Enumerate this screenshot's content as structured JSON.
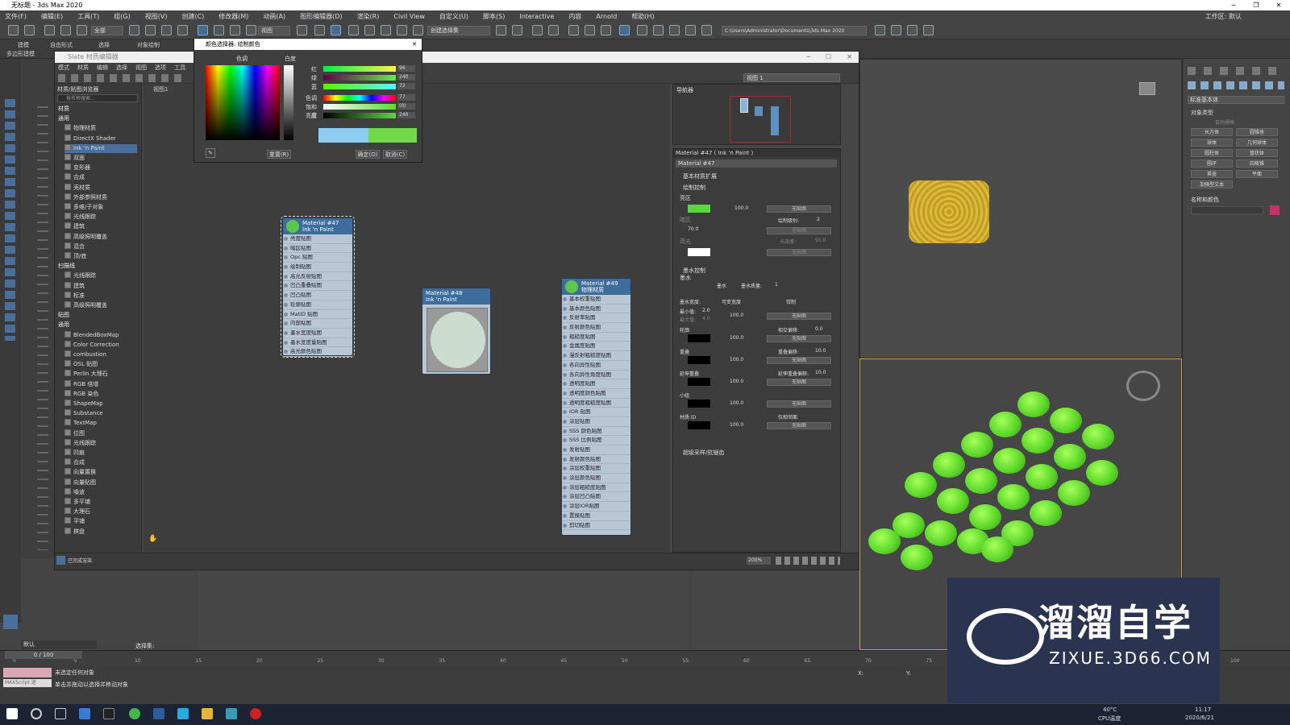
{
  "app": {
    "title": "无标题 - 3ds Max 2020",
    "window_controls": [
      "─",
      "❐",
      "✕"
    ]
  },
  "menubar": {
    "items": [
      "文件(F)",
      "编辑(E)",
      "工具(T)",
      "组(G)",
      "视图(V)",
      "创建(C)",
      "修改器(M)",
      "动画(A)",
      "图形编辑器(D)",
      "渲染(R)",
      "Civil View",
      "自定义(U)",
      "脚本(S)",
      "Interactive",
      "内容",
      "Arnold",
      "帮助(H)"
    ],
    "workspace_label": "工作区:",
    "workspace_value": "默认"
  },
  "toolbar": {
    "filter_select": "全部",
    "view_select": "视图",
    "selection_set": "创建选择集",
    "path": "C:\\Users\\Administrator\\Documents\\3ds Max 2020"
  },
  "ribbon": {
    "tabs": [
      "建模",
      "自由形式",
      "选择",
      "对象绘制"
    ],
    "subtab": "多边形建模"
  },
  "slate": {
    "title": "Slate 材质编辑器",
    "menu": [
      "模式",
      "材质",
      "编辑",
      "选择",
      "视图",
      "选项",
      "工具"
    ],
    "browser_title": "材质/贴图浏览器",
    "search_placeholder": "按名称搜索...",
    "view_tab": "视图1",
    "view_select": "视图 1",
    "nav_title": "导航器",
    "status_text": "已完成渲染",
    "zoom": "200%",
    "browser": {
      "section_materials": "材质",
      "group_general": "通用",
      "general_items": [
        "物理材质",
        "DirectX Shader",
        "Ink 'n Paint",
        "双面",
        "变形器",
        "合成",
        "壳材质",
        "外部参照材质",
        "多维/子对象",
        "光线跟踪",
        "建筑",
        "高级照明覆盖",
        "混合",
        "顶/底"
      ],
      "group_scanline": "扫描线",
      "scanline_items": [
        "光线跟踪",
        "建筑",
        "标准",
        "高级照明覆盖"
      ],
      "section_maps": "贴图",
      "group_maps_general": "通用",
      "map_items": [
        "BlendedBoxMap",
        "Color Correction",
        "combustion",
        "OSL 贴图",
        "Perlin 大理石",
        "RGB 倍增",
        "RGB 染色",
        "ShapeMap",
        "Substance",
        "TextMap",
        "位图",
        "光线跟踪",
        "凹痕",
        "合成",
        "向量置换",
        "向量贴图",
        "噪波",
        "多平铺",
        "大理石",
        "平铺",
        "棋盘"
      ]
    },
    "nodes": {
      "ink": {
        "title": "Material #47",
        "subtitle": "Ink 'n Paint",
        "slots": [
          "亮度贴图",
          "暗区贴图",
          "Opc 贴图",
          "绘制贴图",
          "高光反射贴图",
          "凹凸重叠贴图",
          "凹凸贴图",
          "轮廓贴图",
          "MatID 贴图",
          "内部贴图",
          "墨水宽度贴图",
          "墨水宽度量贴图",
          "高光颜色贴图"
        ]
      },
      "std": {
        "title": "Material #48",
        "subtitle": "Ink 'n Paint"
      },
      "phys": {
        "title": "Material #49",
        "subtitle": "物理材质",
        "slots": [
          "基本权重贴图",
          "基本颜色贴图",
          "反射率贴图",
          "反射颜色贴图",
          "粗糙度贴图",
          "金属度贴图",
          "漫反射粗糙度贴图",
          "各向异性贴图",
          "各向异性角度贴图",
          "透明度贴图",
          "透明度颜色贴图",
          "透明度粗糙度贴图",
          "IOR 贴图",
          "涂层贴图",
          "SSS 颜色贴图",
          "SSS 比例贴图",
          "发射贴图",
          "发射颜色贴图",
          "涂层权重贴图",
          "涂层颜色贴图",
          "涂层粗糙度贴图",
          "涂层凹凸贴图",
          "涂层IOR贴图",
          "置换贴图",
          "剪切贴图"
        ]
      }
    },
    "props": {
      "header": "Material #47 ( Ink 'n Paint )",
      "name": "Material #47",
      "rollout_basic": "基本材质扩展",
      "rollout_paint": "绘制控制",
      "lit_label": "亮区",
      "lit_check": "已启用",
      "lit_value": "100.0",
      "no_map": "无贴图",
      "shaded_label": "暗区",
      "shaded_value": "70.0",
      "paint_levels_label": "绘制级别:",
      "paint_levels": "2",
      "highlight_label": "高光",
      "glossiness_label": "光泽度:",
      "glossiness": "50.0",
      "rollout_ink": "墨水控制",
      "ink_label": "墨水",
      "ink_quality_label": "墨水质量:",
      "ink_quality": "1",
      "ink_width_label": "墨水宽度:",
      "variable_width": "可变宽度",
      "clamp": "钳制",
      "min_label": "最小值:",
      "min": "2.0",
      "max_label": "最大值:",
      "max": "4.0",
      "outline_label": "轮廓",
      "intersect_bias_label": "相交偏移:",
      "intersect_bias": "0.0",
      "overlap_label": "重叠",
      "overlap_bias_label": "重叠偏移:",
      "overlap_bias": "10.0",
      "underlap_label": "延伸重叠",
      "underlap_bias_label": "延伸重叠偏移:",
      "underlap_bias": "10.0",
      "smgroup_label": "小组",
      "matid_label": "材质 ID",
      "only_adjacent": "仅相邻面",
      "rollout_ss": "超级采样/抗锯齿",
      "row_value": "100.0"
    }
  },
  "color_picker": {
    "title": "颜色选择器: 绘制颜色",
    "tab_hue": "色调",
    "tab_white": "白度",
    "labels": [
      "红",
      "绿",
      "蓝",
      "色调",
      "饱和度",
      "亮度"
    ],
    "values": [
      "96",
      "240",
      "72",
      "77",
      "(0)",
      "240"
    ],
    "reset": "重置(R)",
    "ok": "确定(O)",
    "cancel": "取消(C)"
  },
  "command_panel": {
    "dropdown": "标准基本体",
    "rollout_type": "对象类型",
    "autogrid": "自动栅格",
    "buttons": [
      "长方体",
      "圆锥体",
      "球体",
      "几何球体",
      "圆柱体",
      "管状体",
      "圆环",
      "四棱锥",
      "茶壶",
      "平面",
      "加强型文本"
    ],
    "rollout_name": "名称和颜色"
  },
  "timeline": {
    "frame": "0 / 100",
    "ticks": [
      "0",
      "5",
      "10",
      "15",
      "20",
      "25",
      "30",
      "35",
      "40",
      "45",
      "50",
      "55",
      "60",
      "65",
      "70",
      "75",
      "80",
      "85",
      "90",
      "95",
      "100"
    ]
  },
  "status": {
    "layer": "默认",
    "selection_set": "选择集:",
    "message1": "未选定任何对象",
    "message2": "单击并拖动以选择并移动对象",
    "script_label": "MAXScript 迷",
    "x_label": "X:",
    "y_label": "Y:"
  },
  "taskbar": {
    "temp": "40°C",
    "cpu": "CPU温度",
    "time": "11:17",
    "date": "2020/6/21"
  },
  "watermark": {
    "brand": "溜溜自学",
    "url": "ZIXUE.3D66.COM"
  },
  "colors": {
    "paint_green": "#5ad93a",
    "node_header": "#3d6d9c",
    "selection": "#4a6f9a",
    "object_color": "#c8306a"
  }
}
